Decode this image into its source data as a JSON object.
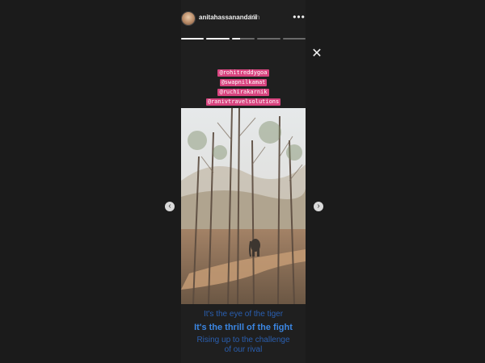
{
  "header": {
    "username": "anitahassanandani",
    "timestamp": "13h",
    "more_icon": "more-horizontal-icon"
  },
  "progress": [
    1,
    1,
    0.35,
    0,
    0
  ],
  "controls": {
    "close_icon": "close-icon",
    "prev_icon": "chevron-left-icon",
    "next_icon": "chevron-right-icon"
  },
  "tags": [
    "@rohitreddygoa",
    "@swapnilkamat",
    "@ruchirakarnik",
    "@ranivtravelsolutions"
  ],
  "lyrics": [
    "It's the eye of the tiger",
    "It's the thrill of the fight",
    "Rising up to the challenge",
    "of our rival"
  ],
  "colors": {
    "background": "#1b1b1b",
    "tag_background": "#d8447f",
    "lyric_active": "#3b86e2",
    "lyric_inactive": "#2a5fb0"
  }
}
